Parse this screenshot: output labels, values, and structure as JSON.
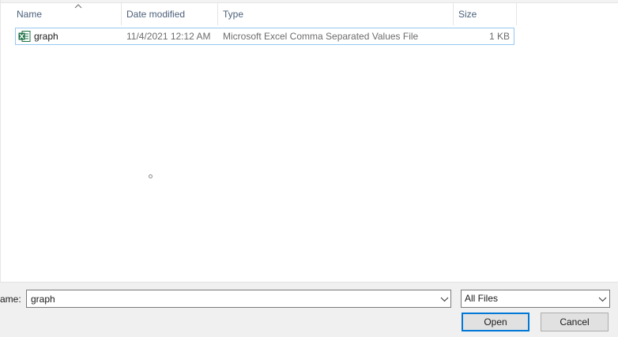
{
  "columns": {
    "name": "Name",
    "date_modified": "Date modified",
    "type": "Type",
    "size": "Size"
  },
  "files": [
    {
      "icon": "excel-csv-icon",
      "name": "graph",
      "date_modified": "11/4/2021 12:12 AM",
      "type": "Microsoft Excel Comma Separated Values File",
      "size": "1 KB"
    }
  ],
  "bottom": {
    "file_name_label": "ame:",
    "file_name_value": "graph",
    "file_type_filter": "All Files",
    "open_label": "Open",
    "cancel_label": "Cancel"
  },
  "colors": {
    "header_text": "#4c607a",
    "selection_border": "#99c9ef",
    "accent": "#0078d7",
    "excel_green": "#1e7145"
  }
}
